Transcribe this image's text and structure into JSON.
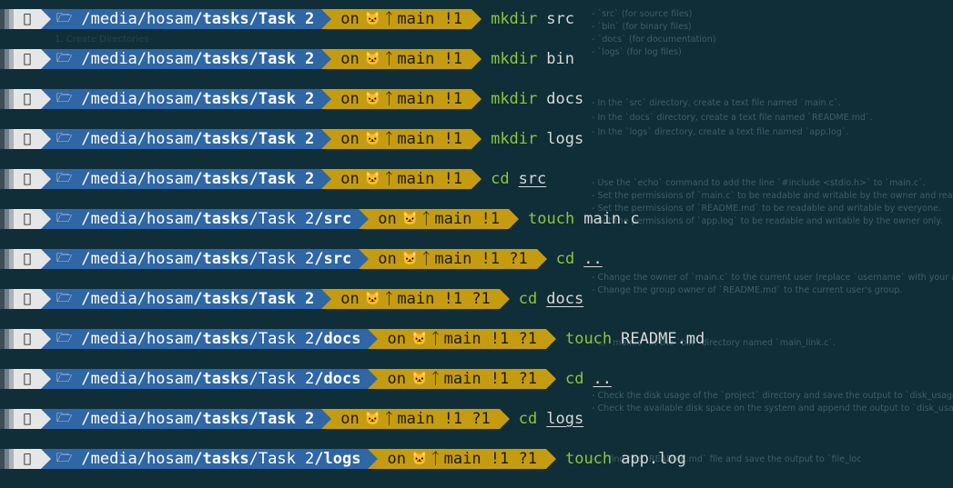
{
  "lines": [
    {
      "path_parts": [
        "/media",
        "/hosam",
        "/tasks",
        "/Task 2",
        ""
      ],
      "git": "main !1",
      "cmd": "mkdir",
      "arg": "src",
      "ul": false
    },
    {
      "path_parts": [
        "/media",
        "/hosam",
        "/tasks",
        "/Task 2",
        ""
      ],
      "git": "main !1",
      "cmd": "mkdir",
      "arg": "bin",
      "ul": false
    },
    {
      "path_parts": [
        "/media",
        "/hosam",
        "/tasks",
        "/Task 2",
        ""
      ],
      "git": "main !1",
      "cmd": "mkdir",
      "arg": "docs",
      "ul": false
    },
    {
      "path_parts": [
        "/media",
        "/hosam",
        "/tasks",
        "/Task 2",
        ""
      ],
      "git": "main !1",
      "cmd": "mkdir",
      "arg": "logs",
      "ul": false
    },
    {
      "path_parts": [
        "/media",
        "/hosam",
        "/tasks",
        "/Task 2",
        ""
      ],
      "git": "main !1",
      "cmd": "cd",
      "arg": "src",
      "ul": true
    },
    {
      "path_parts": [
        "/media",
        "/hosam",
        "/tasks",
        "/Task 2",
        "/src"
      ],
      "git": "main !1",
      "cmd": "touch",
      "arg": "main.c",
      "ul": false
    },
    {
      "path_parts": [
        "/media",
        "/hosam",
        "/tasks",
        "/Task 2",
        "/src"
      ],
      "git": "main !1 ?1",
      "cmd": "cd",
      "arg": "..",
      "ul": true
    },
    {
      "path_parts": [
        "/media",
        "/hosam",
        "/tasks",
        "/Task 2",
        ""
      ],
      "git": "main !1 ?1",
      "cmd": "cd",
      "arg": "docs",
      "ul": true
    },
    {
      "path_parts": [
        "/media",
        "/hosam",
        "/tasks",
        "/Task 2",
        "/docs"
      ],
      "git": "main !1 ?1",
      "cmd": "touch",
      "arg": "README.md",
      "ul": false
    },
    {
      "path_parts": [
        "/media",
        "/hosam",
        "/tasks",
        "/Task 2",
        "/docs"
      ],
      "git": "main !1 ?1",
      "cmd": "cd",
      "arg": "..",
      "ul": true
    },
    {
      "path_parts": [
        "/media",
        "/hosam",
        "/tasks",
        "/Task 2",
        ""
      ],
      "git": "main !1 ?1",
      "cmd": "cd",
      "arg": "logs",
      "ul": true
    },
    {
      "path_parts": [
        "/media",
        "/hosam",
        "/tasks",
        "/Task 2",
        "/logs"
      ],
      "git": "main !1 ?1",
      "cmd": "touch",
      "arg": "app.log",
      "ul": false
    }
  ],
  "git_prefix": "on",
  "icons": {
    "os": "apple-icon",
    "folder": "folder-icon",
    "github": "github-icon",
    "branch": "git-branch-icon"
  },
  "colors": {
    "background": "#0f2e38",
    "path_segment": "#2f66a5",
    "git_segment": "#c59c0f",
    "os_segment": "#e6e6e6",
    "command": "#8ec43b"
  },
  "bg_notes": [
    "- `src` (for source files)",
    "- `bin` (for binary files)",
    "- `docs` (for documentation)",
    "- `logs` (for log files)",
    "- In the `src` directory, create a text file named `main.c`.",
    "- In the `docs` directory, create a text file named `README.md`.",
    "- In the `logs` directory, create a text file named `app.log`.",
    "- Use the `echo` command to add the line `#include <stdio.h>` to `main.c`.",
    "- Set the permissions of `main.c` to be readable and writable by the owner and readable",
    "- Set the permissions of `README.md` to be readable and writable by everyone.",
    "- Set the permissions of `app.log` to be readable and writable by the owner only.",
    "- Change the owner of `main.c` to the current user (replace `username` with your actual",
    "- Change the group owner of `README.md` to the current user's group.",
    "- ... `main.c` in the `bin` directory named `main_link.c`.",
    "- Check the disk usage of the `project` directory and save the output to `disk_usage.txt`.",
    "- Check the available disk space on the system and append the output to `disk_usage.txt`.",
    "- ... find the `README.md` file and save the output to `file_loc"
  ],
  "bg_faint": "1. Create Directories"
}
